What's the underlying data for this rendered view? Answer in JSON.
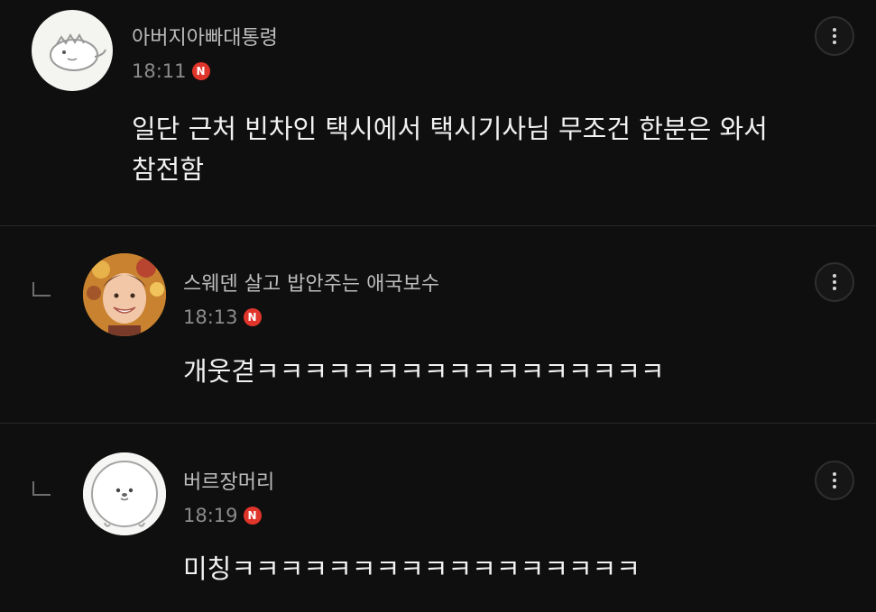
{
  "comments": [
    {
      "author": "아버지아빠대통령",
      "time": "18:11",
      "badge": "N",
      "text_lines": [
        "일단 근처 빈차인 택시에서 택시기사님 무조건 한분은 와서",
        "참전함"
      ],
      "avatar_icon": "dinosaur-avatar-icon",
      "more_icon": "more-vertical-icon"
    },
    {
      "author": "스웨덴 살고 밥안주는 애국보수",
      "time": "18:13",
      "badge": "N",
      "text_lines": [
        "개웃겯ㅋㅋㅋㅋㅋㅋㅋㅋㅋㅋㅋㅋㅋㅋㅋㅋㅋ"
      ],
      "avatar_icon": "portrait-avatar-icon",
      "reply_icon": "reply-arrow-icon",
      "more_icon": "more-vertical-icon"
    },
    {
      "author": "버르장머리",
      "time": "18:19",
      "badge": "N",
      "text_lines": [
        "미칭ㅋㅋㅋㅋㅋㅋㅋㅋㅋㅋㅋㅋㅋㅋㅋㅋㅋ"
      ],
      "avatar_icon": "round-character-avatar-icon",
      "reply_icon": "reply-arrow-icon",
      "more_icon": "more-vertical-icon"
    }
  ],
  "colors": {
    "background": "#0f0f0f",
    "new_badge": "#e0352b",
    "author_text": "#bdbdbd",
    "body_text": "#f2f2f2",
    "time_text": "#8b8b8b"
  }
}
